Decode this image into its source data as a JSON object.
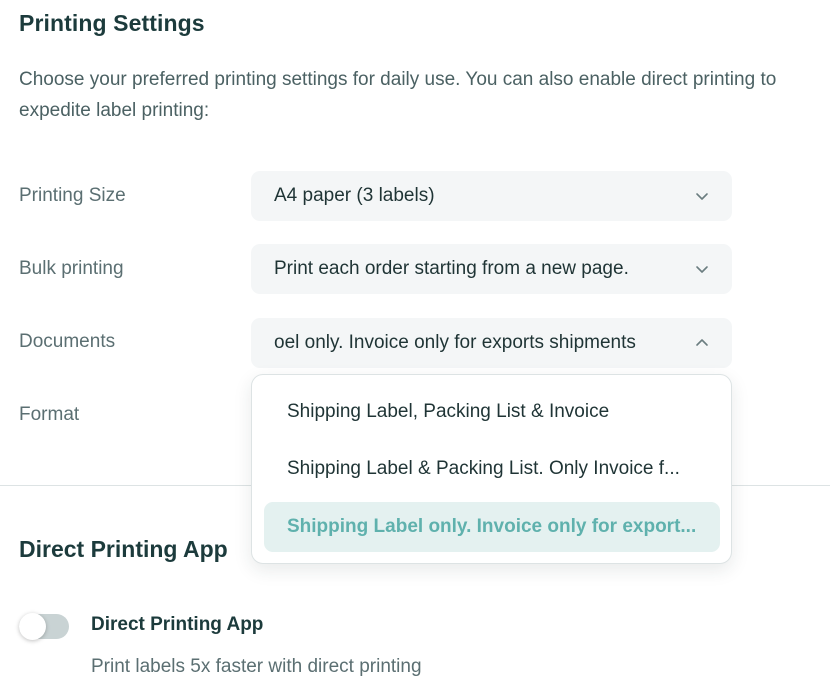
{
  "settings": {
    "title": "Printing Settings",
    "description": "Choose your preferred printing settings for daily use. You can also enable direct printing to expedite label printing:",
    "rows": {
      "size": {
        "label": "Printing Size",
        "value": "A4 paper (3 labels)"
      },
      "bulk": {
        "label": "Bulk printing",
        "value": "Print each order starting from a new page."
      },
      "documents": {
        "label": "Documents",
        "value": "oel only. Invoice only for exports shipments"
      },
      "format": {
        "label": "Format"
      }
    },
    "documents_options": [
      "Shipping Label, Packing List & Invoice",
      "Shipping Label & Packing List. Only Invoice f...",
      "Shipping Label only. Invoice only for export..."
    ]
  },
  "direct_printing": {
    "section_title": "Direct Printing App",
    "toggle_label": "Direct Printing App",
    "toggle_description": "Print labels 5x faster with direct printing",
    "enabled": false
  },
  "colors": {
    "accent": "#5fb1ad",
    "selected_bg": "#e4f1f0",
    "field_bg": "#f4f6f7"
  }
}
